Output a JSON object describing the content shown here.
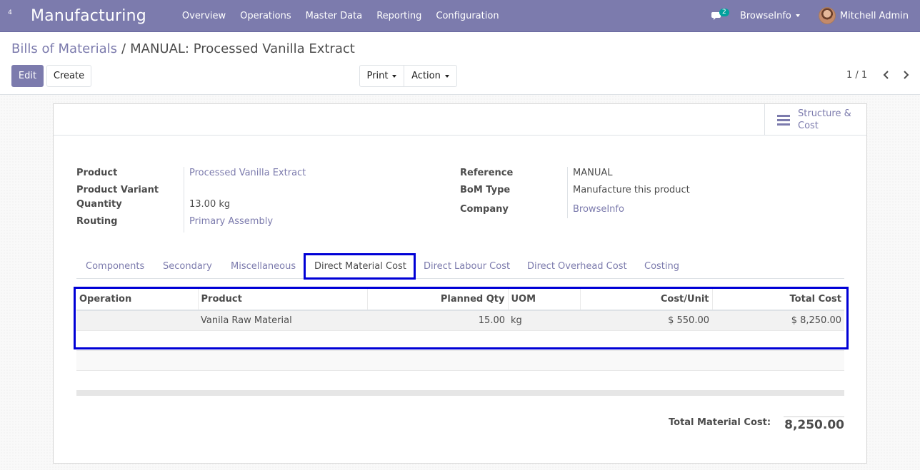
{
  "navbar": {
    "apps_badge": "4",
    "brand": "Manufacturing",
    "menu": [
      "Overview",
      "Operations",
      "Master Data",
      "Reporting",
      "Configuration"
    ],
    "chat_count": "2",
    "company": "BrowseInfo",
    "user": "Mitchell Admin"
  },
  "breadcrumb": {
    "parent": "Bills of Materials",
    "separator": "/",
    "current": "MANUAL: Processed Vanilla Extract"
  },
  "buttons": {
    "edit": "Edit",
    "create": "Create",
    "print": "Print",
    "action": "Action"
  },
  "pager": {
    "value": "1 / 1"
  },
  "smart_button": {
    "label_line1": "Structure &",
    "label_line2": "Cost"
  },
  "fields": {
    "product_label": "Product",
    "product_value": "Processed Vanilla Extract",
    "variant_label": "Product Variant",
    "quantity_label": "Quantity",
    "quantity_value": "13.00 kg",
    "routing_label": "Routing",
    "routing_value": "Primary Assembly",
    "reference_label": "Reference",
    "reference_value": "MANUAL",
    "bom_type_label": "BoM Type",
    "bom_type_value": "Manufacture this product",
    "company_label": "Company",
    "company_value": "BrowseInfo"
  },
  "tabs": [
    "Components",
    "Secondary",
    "Miscellaneous",
    "Direct Material Cost",
    "Direct Labour Cost",
    "Direct Overhead Cost",
    "Costing"
  ],
  "active_tab": "Direct Material Cost",
  "table": {
    "headers": [
      "Operation",
      "Product",
      "Planned Qty",
      "UOM",
      "Cost/Unit",
      "Total Cost"
    ],
    "rows": [
      {
        "operation": "",
        "product": "Vanila Raw Material",
        "planned_qty": "15.00",
        "uom": "kg",
        "cost_unit": "$ 550.00",
        "total_cost": "$ 8,250.00"
      }
    ]
  },
  "totals": {
    "label": "Total Material Cost:",
    "value": "8,250.00"
  },
  "colors": {
    "brand": "#7c7bad",
    "highlight": "#0000d6"
  }
}
